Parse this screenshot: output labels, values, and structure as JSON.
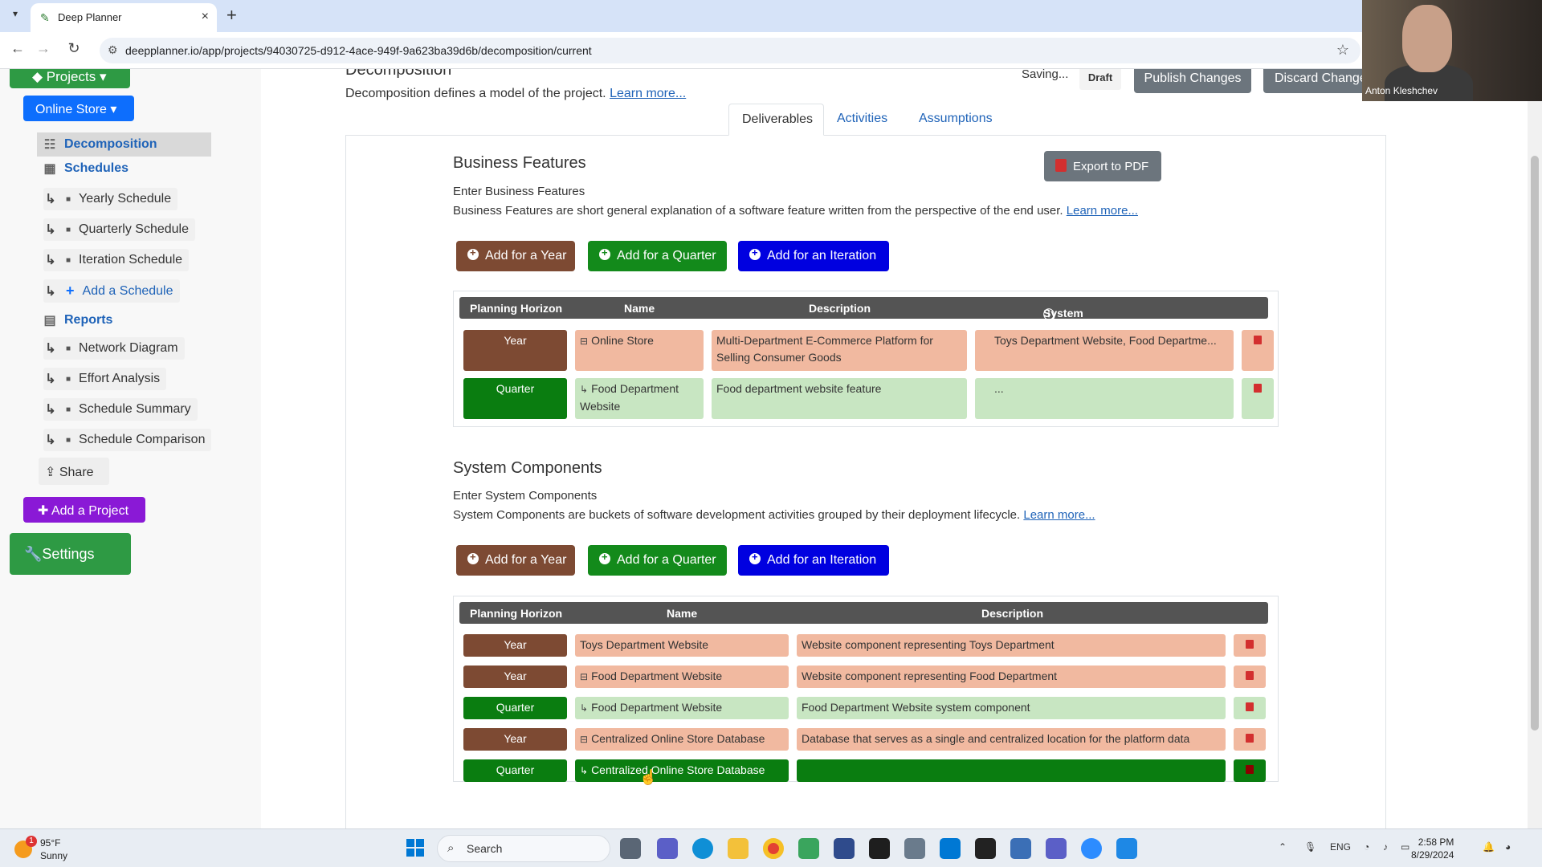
{
  "browser": {
    "tab_title": "Deep Planner",
    "url": "deepplanner.io/app/projects/94030725-d912-4ace-949f-9a623ba39d6b/decomposition/current"
  },
  "sidebar": {
    "projects_label": "Projects",
    "project_label": "Online Store",
    "decomposition": "Decomposition",
    "schedules": "Schedules",
    "schedule_items": [
      "Yearly Schedule",
      "Quarterly Schedule",
      "Iteration Schedule"
    ],
    "add_schedule": "Add a Schedule",
    "reports": "Reports",
    "report_items": [
      "Network Diagram",
      "Effort Analysis",
      "Schedule Summary",
      "Schedule Comparison"
    ],
    "share": "Share",
    "add_project": "Add a Project",
    "settings": "Settings"
  },
  "header": {
    "title": "Decomposition",
    "description": "Decomposition defines a model of the project.",
    "learn_more": "Learn more...",
    "saving": "Saving...",
    "draft": "Draft",
    "publish": "Publish Changes",
    "discard": "Discard Changes"
  },
  "tabs": [
    "Deliverables",
    "Activities",
    "Assumptions"
  ],
  "business": {
    "title": "Business Features",
    "enter": "Enter Business Features",
    "description": "Business Features are short general explanation of a software feature written from the perspective of the end user.",
    "learn_more": "Learn more...",
    "export": "Export to PDF",
    "add_year": "Add for a Year",
    "add_quarter": "Add for a Quarter",
    "add_iteration": "Add for an Iteration",
    "columns": [
      "Planning Horizon",
      "Name",
      "Description",
      "System Components"
    ],
    "rows": [
      {
        "horizon": "Year",
        "name": "Online Store",
        "description": "Multi-Department E-Commerce Platform for Selling Consumer Goods",
        "components": "Toys Department Website, Food Departme..."
      },
      {
        "horizon": "Quarter",
        "name": "Food Department Website",
        "description": "Food department website feature",
        "components": "..."
      }
    ]
  },
  "system": {
    "title": "System Components",
    "enter": "Enter System Components",
    "description": "System Components are buckets of software development activities grouped by their deployment lifecycle.",
    "learn_more": "Learn more...",
    "add_year": "Add for a Year",
    "add_quarter": "Add for a Quarter",
    "add_iteration": "Add for an Iteration",
    "columns": [
      "Planning Horizon",
      "Name",
      "Description"
    ],
    "rows": [
      {
        "horizon": "Year",
        "name": "Toys Department Website",
        "description": "Website component representing Toys Department"
      },
      {
        "horizon": "Year",
        "name": "Food Department Website",
        "description": "Website component representing Food Department"
      },
      {
        "horizon": "Quarter",
        "name": "Food Department Website",
        "description": "Food Department Website system component"
      },
      {
        "horizon": "Year",
        "name": "Centralized Online Store Database",
        "description": "Database that serves as a single and centralized location for the platform data"
      },
      {
        "horizon": "Quarter",
        "name": "Centralized Online Store Database",
        "description": ""
      }
    ]
  },
  "webcam": {
    "name": "Anton Kleshchev"
  },
  "taskbar": {
    "temp": "95°F",
    "condition": "Sunny",
    "weather_badge": "1",
    "search": "Search",
    "lang": "ENG",
    "time": "2:58 PM",
    "date": "8/29/2024"
  }
}
